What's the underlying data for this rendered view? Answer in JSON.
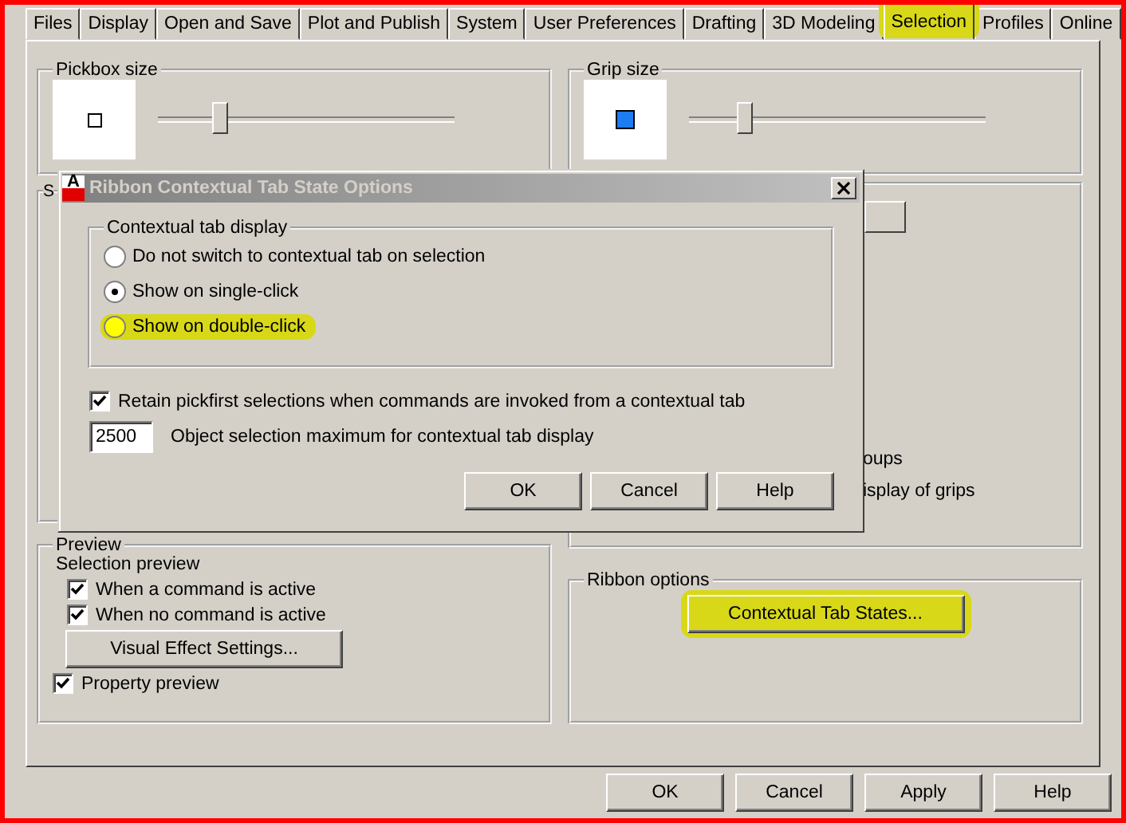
{
  "tabs": [
    {
      "label": "Files",
      "selected": false,
      "highlighted": false
    },
    {
      "label": "Display",
      "selected": false,
      "highlighted": false
    },
    {
      "label": "Open and Save",
      "selected": false,
      "highlighted": false
    },
    {
      "label": "Plot and Publish",
      "selected": false,
      "highlighted": false
    },
    {
      "label": "System",
      "selected": false,
      "highlighted": false
    },
    {
      "label": "User Preferences",
      "selected": false,
      "highlighted": false
    },
    {
      "label": "Drafting",
      "selected": false,
      "highlighted": false
    },
    {
      "label": "3D Modeling",
      "selected": false,
      "highlighted": false
    },
    {
      "label": "Selection",
      "selected": true,
      "highlighted": true
    },
    {
      "label": "Profiles",
      "selected": false,
      "highlighted": false
    },
    {
      "label": "Online",
      "selected": false,
      "highlighted": false
    }
  ],
  "pickbox": {
    "title": "Pickbox size",
    "level": 0.21
  },
  "grip": {
    "title": "Grip size",
    "level": 0.19
  },
  "selection_modes": {
    "title_fragment": "S"
  },
  "grips": {
    "fragments": [
      "oups",
      "isplay of grips"
    ]
  },
  "preview": {
    "title": "Preview",
    "subtitle": "Selection preview",
    "checks": [
      {
        "label": "When a command is active",
        "checked": true
      },
      {
        "label": "When no command is active",
        "checked": true
      }
    ],
    "button": "Visual Effect Settings...",
    "property": {
      "label": "Property preview",
      "checked": true
    }
  },
  "ribbon": {
    "title": "Ribbon options",
    "button": {
      "label": "Contextual Tab States...",
      "highlighted": true
    }
  },
  "buttons": [
    "OK",
    "Cancel",
    "Apply",
    "Help"
  ],
  "dialog": {
    "icon_letter": "A",
    "title": "Ribbon Contextual Tab State Options",
    "group_title": "Contextual tab display",
    "options": [
      {
        "label": "Do not switch to contextual tab on selection",
        "selected": false,
        "highlighted": false
      },
      {
        "label": "Show on single-click",
        "selected": true,
        "highlighted": false
      },
      {
        "label": "Show on double-click",
        "selected": false,
        "highlighted": true
      }
    ],
    "retain": {
      "label": "Retain pickfirst selections when commands are invoked from a contextual tab",
      "checked": true
    },
    "max": {
      "value": "2500",
      "label": "Object selection maximum for contextual tab display"
    },
    "buttons": [
      "OK",
      "Cancel",
      "Help"
    ]
  }
}
